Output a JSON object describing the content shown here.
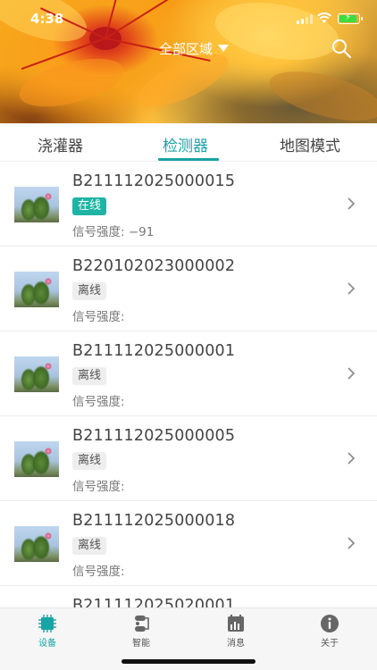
{
  "status_bar": {
    "time": "4:38"
  },
  "header": {
    "region_label": "全部区域"
  },
  "tabs": [
    {
      "label": "浇灌器",
      "active": false
    },
    {
      "label": "检测器",
      "active": true
    },
    {
      "label": "地图模式",
      "active": false
    }
  ],
  "devices": [
    {
      "id": "B211112025000015",
      "status": "在线",
      "online": true,
      "signal_label": "信号强度:",
      "signal_value": "−91"
    },
    {
      "id": "B220102023000002",
      "status": "离线",
      "online": false,
      "signal_label": "信号强度:",
      "signal_value": ""
    },
    {
      "id": "B211112025000001",
      "status": "离线",
      "online": false,
      "signal_label": "信号强度:",
      "signal_value": ""
    },
    {
      "id": "B211112025000005",
      "status": "离线",
      "online": false,
      "signal_label": "信号强度:",
      "signal_value": ""
    },
    {
      "id": "B211112025000018",
      "status": "离线",
      "online": false,
      "signal_label": "信号强度:",
      "signal_value": ""
    },
    {
      "id": "B211112025020001",
      "status": "",
      "online": false,
      "signal_label": "",
      "signal_value": ""
    }
  ],
  "bottom_nav": [
    {
      "label": "设备",
      "icon": "chip-icon",
      "active": true
    },
    {
      "label": "智能",
      "icon": "automation-icon",
      "active": false
    },
    {
      "label": "消息",
      "icon": "calendar-chart-icon",
      "active": false
    },
    {
      "label": "关于",
      "icon": "info-icon",
      "active": false
    }
  ],
  "colors": {
    "accent": "#1aa3a6",
    "online_badge": "#1fb4a5",
    "offline_badge": "#eeeeee"
  }
}
